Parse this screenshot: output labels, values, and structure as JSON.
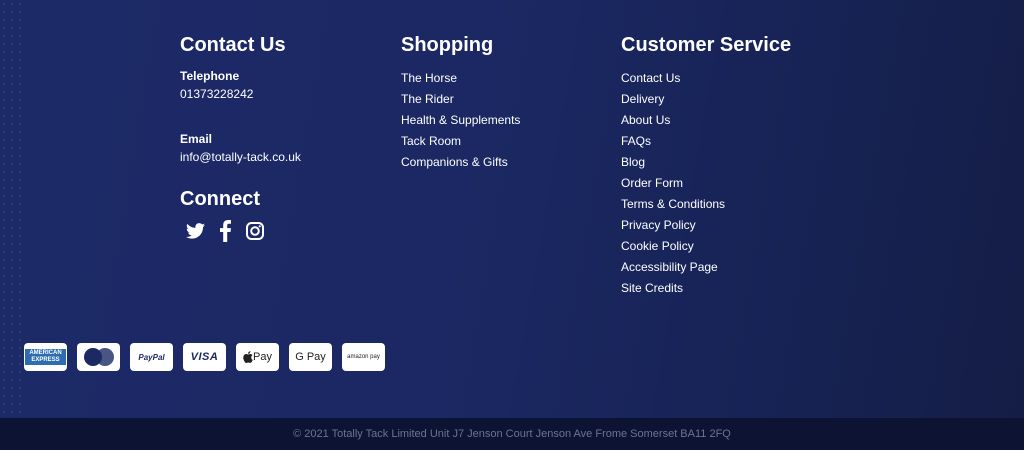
{
  "contact": {
    "heading": "Contact Us",
    "telephone_label": "Telephone",
    "telephone_value": "01373228242",
    "email_label": "Email",
    "email_value": "info@totally-tack.co.uk"
  },
  "connect": {
    "heading": "Connect",
    "icons": [
      "twitter-icon",
      "facebook-icon",
      "instagram-icon"
    ]
  },
  "shopping": {
    "heading": "Shopping",
    "links": [
      "The Horse",
      "The Rider",
      "Health & Supplements",
      "Tack Room",
      "Companions & Gifts"
    ]
  },
  "service": {
    "heading": "Customer Service",
    "links": [
      "Contact Us",
      "Delivery",
      "About Us",
      "FAQs",
      "Blog",
      "Order Form",
      "Terms & Conditions",
      "Privacy Policy",
      "Cookie Policy",
      "Accessibility Page",
      "Site Credits"
    ]
  },
  "payments": {
    "amex": "AMERICAN EXPRESS",
    "paypal": "PayPal",
    "visa": "VISA",
    "apple_pay": "Pay",
    "google_pay": "G Pay",
    "amazon_pay": "amazon pay"
  },
  "footer": {
    "copyright": "© 2021 Totally Tack Limited Unit J7 Jenson Court Jenson Ave Frome Somerset BA11 2FQ"
  },
  "colors": {
    "background": "#1b2863",
    "footer_bar": "#0d1333",
    "footer_text": "#6d7390",
    "text": "#ffffff"
  }
}
